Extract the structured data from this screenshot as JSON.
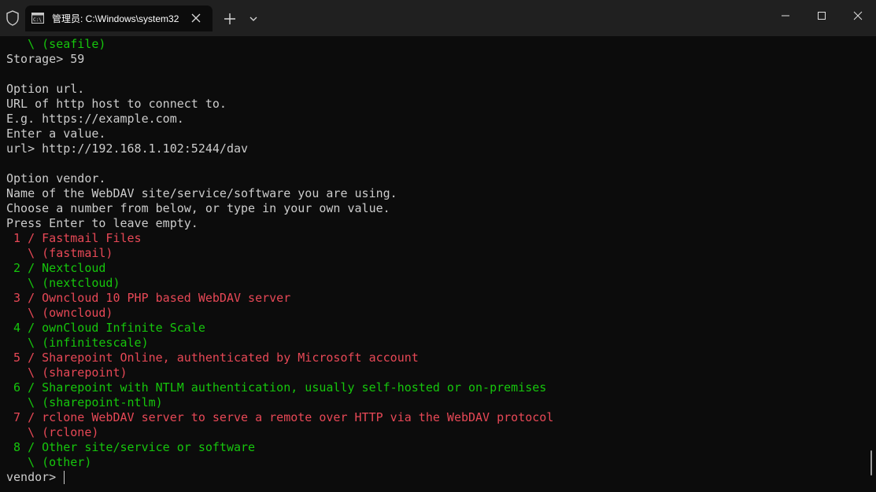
{
  "window": {
    "tab_title": "管理员: C:\\Windows\\system32",
    "icons": {
      "shield": "shield-icon",
      "tab": "terminal-icon",
      "close_tab": "close-icon",
      "new_tab": "plus-icon",
      "dropdown": "chevron-down-icon",
      "minimize": "minimize-icon",
      "maximize": "maximize-icon",
      "close": "close-icon"
    }
  },
  "colors": {
    "background": "#0c0c0c",
    "titlebar": "#202020",
    "default_text": "#cccccc",
    "green": "#16c60c",
    "red": "#e74856"
  },
  "terminal": {
    "lines": [
      {
        "text": "   \\ (seafile)",
        "color": "green"
      },
      {
        "text": "Storage> 59",
        "color": "default"
      },
      {
        "text": "",
        "color": "default"
      },
      {
        "text": "Option url.",
        "color": "default"
      },
      {
        "text": "URL of http host to connect to.",
        "color": "default"
      },
      {
        "text": "E.g. https://example.com.",
        "color": "default"
      },
      {
        "text": "Enter a value.",
        "color": "default"
      },
      {
        "text": "url> http://192.168.1.102:5244/dav",
        "color": "default"
      },
      {
        "text": "",
        "color": "default"
      },
      {
        "text": "Option vendor.",
        "color": "default"
      },
      {
        "text": "Name of the WebDAV site/service/software you are using.",
        "color": "default"
      },
      {
        "text": "Choose a number from below, or type in your own value.",
        "color": "default"
      },
      {
        "text": "Press Enter to leave empty.",
        "color": "default"
      },
      {
        "text": " 1 / Fastmail Files",
        "color": "red"
      },
      {
        "text": "   \\ (fastmail)",
        "color": "red"
      },
      {
        "text": " 2 / Nextcloud",
        "color": "green"
      },
      {
        "text": "   \\ (nextcloud)",
        "color": "green"
      },
      {
        "text": " 3 / Owncloud 10 PHP based WebDAV server",
        "color": "red"
      },
      {
        "text": "   \\ (owncloud)",
        "color": "red"
      },
      {
        "text": " 4 / ownCloud Infinite Scale",
        "color": "green"
      },
      {
        "text": "   \\ (infinitescale)",
        "color": "green"
      },
      {
        "text": " 5 / Sharepoint Online, authenticated by Microsoft account",
        "color": "red"
      },
      {
        "text": "   \\ (sharepoint)",
        "color": "red"
      },
      {
        "text": " 6 / Sharepoint with NTLM authentication, usually self-hosted or on-premises",
        "color": "green"
      },
      {
        "text": "   \\ (sharepoint-ntlm)",
        "color": "green"
      },
      {
        "text": " 7 / rclone WebDAV server to serve a remote over HTTP via the WebDAV protocol",
        "color": "red"
      },
      {
        "text": "   \\ (rclone)",
        "color": "red"
      },
      {
        "text": " 8 / Other site/service or software",
        "color": "green"
      },
      {
        "text": "   \\ (other)",
        "color": "green"
      }
    ],
    "prompt": "vendor> ",
    "input_value": ""
  }
}
